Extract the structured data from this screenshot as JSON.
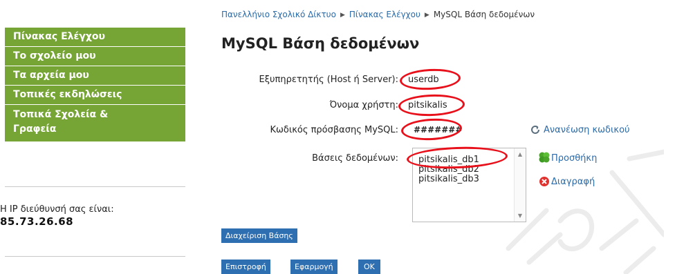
{
  "sidebar": {
    "items": [
      {
        "label": "Πίνακας Ελέγχου"
      },
      {
        "label": "Το σχολείο μου"
      },
      {
        "label": "Τα αρχεία μου"
      },
      {
        "label": "Τοπικές εκδηλώσεις"
      },
      {
        "label_line1": "Τοπικά Σχολεία &",
        "label_line2": "Γραφεία"
      }
    ],
    "ip_label": "Η IP διεύθυνσή σας είναι:",
    "ip_value": "85.73.26.68"
  },
  "breadcrumb": {
    "items": [
      "Πανελλήνιο Σχολικό Δίκτυο",
      "Πίνακας Ελέγχου",
      "MySQL Βάση δεδομένων"
    ]
  },
  "page_title": "MySQL Βάση δεδομένων",
  "form": {
    "host_label": "Εξυπηρετητής (Host ή Server):",
    "host_value": "userdb",
    "user_label": "Όνομα χρήστη:",
    "user_value": "pitsikalis",
    "password_label": "Κωδικός πρόσβασης MySQL:",
    "password_value": "#######",
    "refresh_password": "Ανανέωση κωδικού",
    "databases_label": "Βάσεις δεδομένων:",
    "databases": [
      "pitsikalis_db1",
      "pitsikalis_db2",
      "pitsikalis_db3"
    ],
    "add": "Προσθήκη",
    "delete": "Διαγραφή"
  },
  "buttons": {
    "manage": "Διαχείριση Βάσης",
    "back": "Επιστροφή",
    "apply": "Εφαρμογή",
    "ok": "OK"
  },
  "colors": {
    "nav_green": "#76a536",
    "link_blue": "#2a6aa8",
    "button_blue": "#2e6fb2",
    "highlight_red": "#e8101a"
  }
}
